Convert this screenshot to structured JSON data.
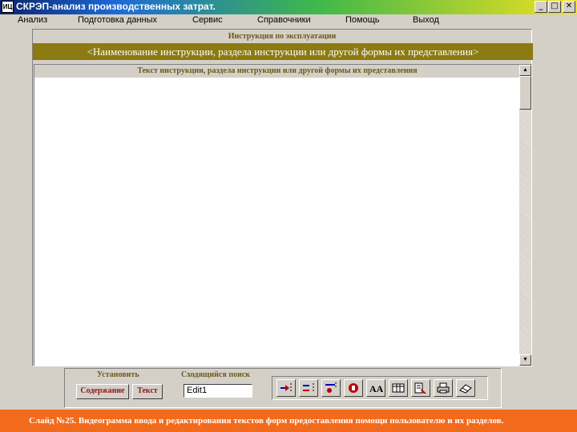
{
  "window": {
    "icon_text": "ИЦ",
    "title": "СКРЭП-анализ производственных затрат.",
    "minimize": "_",
    "maximize": "□",
    "close": "✕"
  },
  "menu": {
    "items": [
      {
        "label": "Анализ"
      },
      {
        "label": "Подготовка данных"
      },
      {
        "label": "Сервис"
      },
      {
        "label": "Справочники"
      },
      {
        "label": "Помощь"
      },
      {
        "label": "Выход"
      }
    ]
  },
  "panel": {
    "caption": "Инструкция по эксплуатации",
    "name_bar": "<Наименование инструкции, раздела инструкции или другой формы их представления>"
  },
  "text_area": {
    "header": "Текст инструкции, раздела инструкции или другой формы их представления",
    "scroll_up": "▲",
    "scroll_down": "▼"
  },
  "bottom": {
    "set_label": "Установить",
    "search_label": "Сходящийся поиск",
    "contents_button": "Содержание",
    "text_button": "Текст",
    "edit_value": "Edit1"
  },
  "toolbar": {
    "tools": [
      {
        "icon": "insert-row-icon"
      },
      {
        "icon": "delete-row-icon"
      },
      {
        "icon": "add-item-icon"
      },
      {
        "icon": "stop-icon"
      },
      {
        "icon": "font-icon",
        "text": "AA"
      },
      {
        "icon": "table-icon"
      },
      {
        "icon": "edit-doc-icon"
      },
      {
        "icon": "print-icon"
      },
      {
        "icon": "eraser-icon"
      }
    ]
  },
  "status": {
    "text": "Слайд №25. Видеограмма ввода и редактирования текстов форм предоставления помощи пользователю и их разделов."
  },
  "colors": {
    "window_bg": "#d4d0c8",
    "name_bar": "#8c7a12",
    "status_bar": "#f26a1b",
    "button_text": "#8b1a1a"
  }
}
